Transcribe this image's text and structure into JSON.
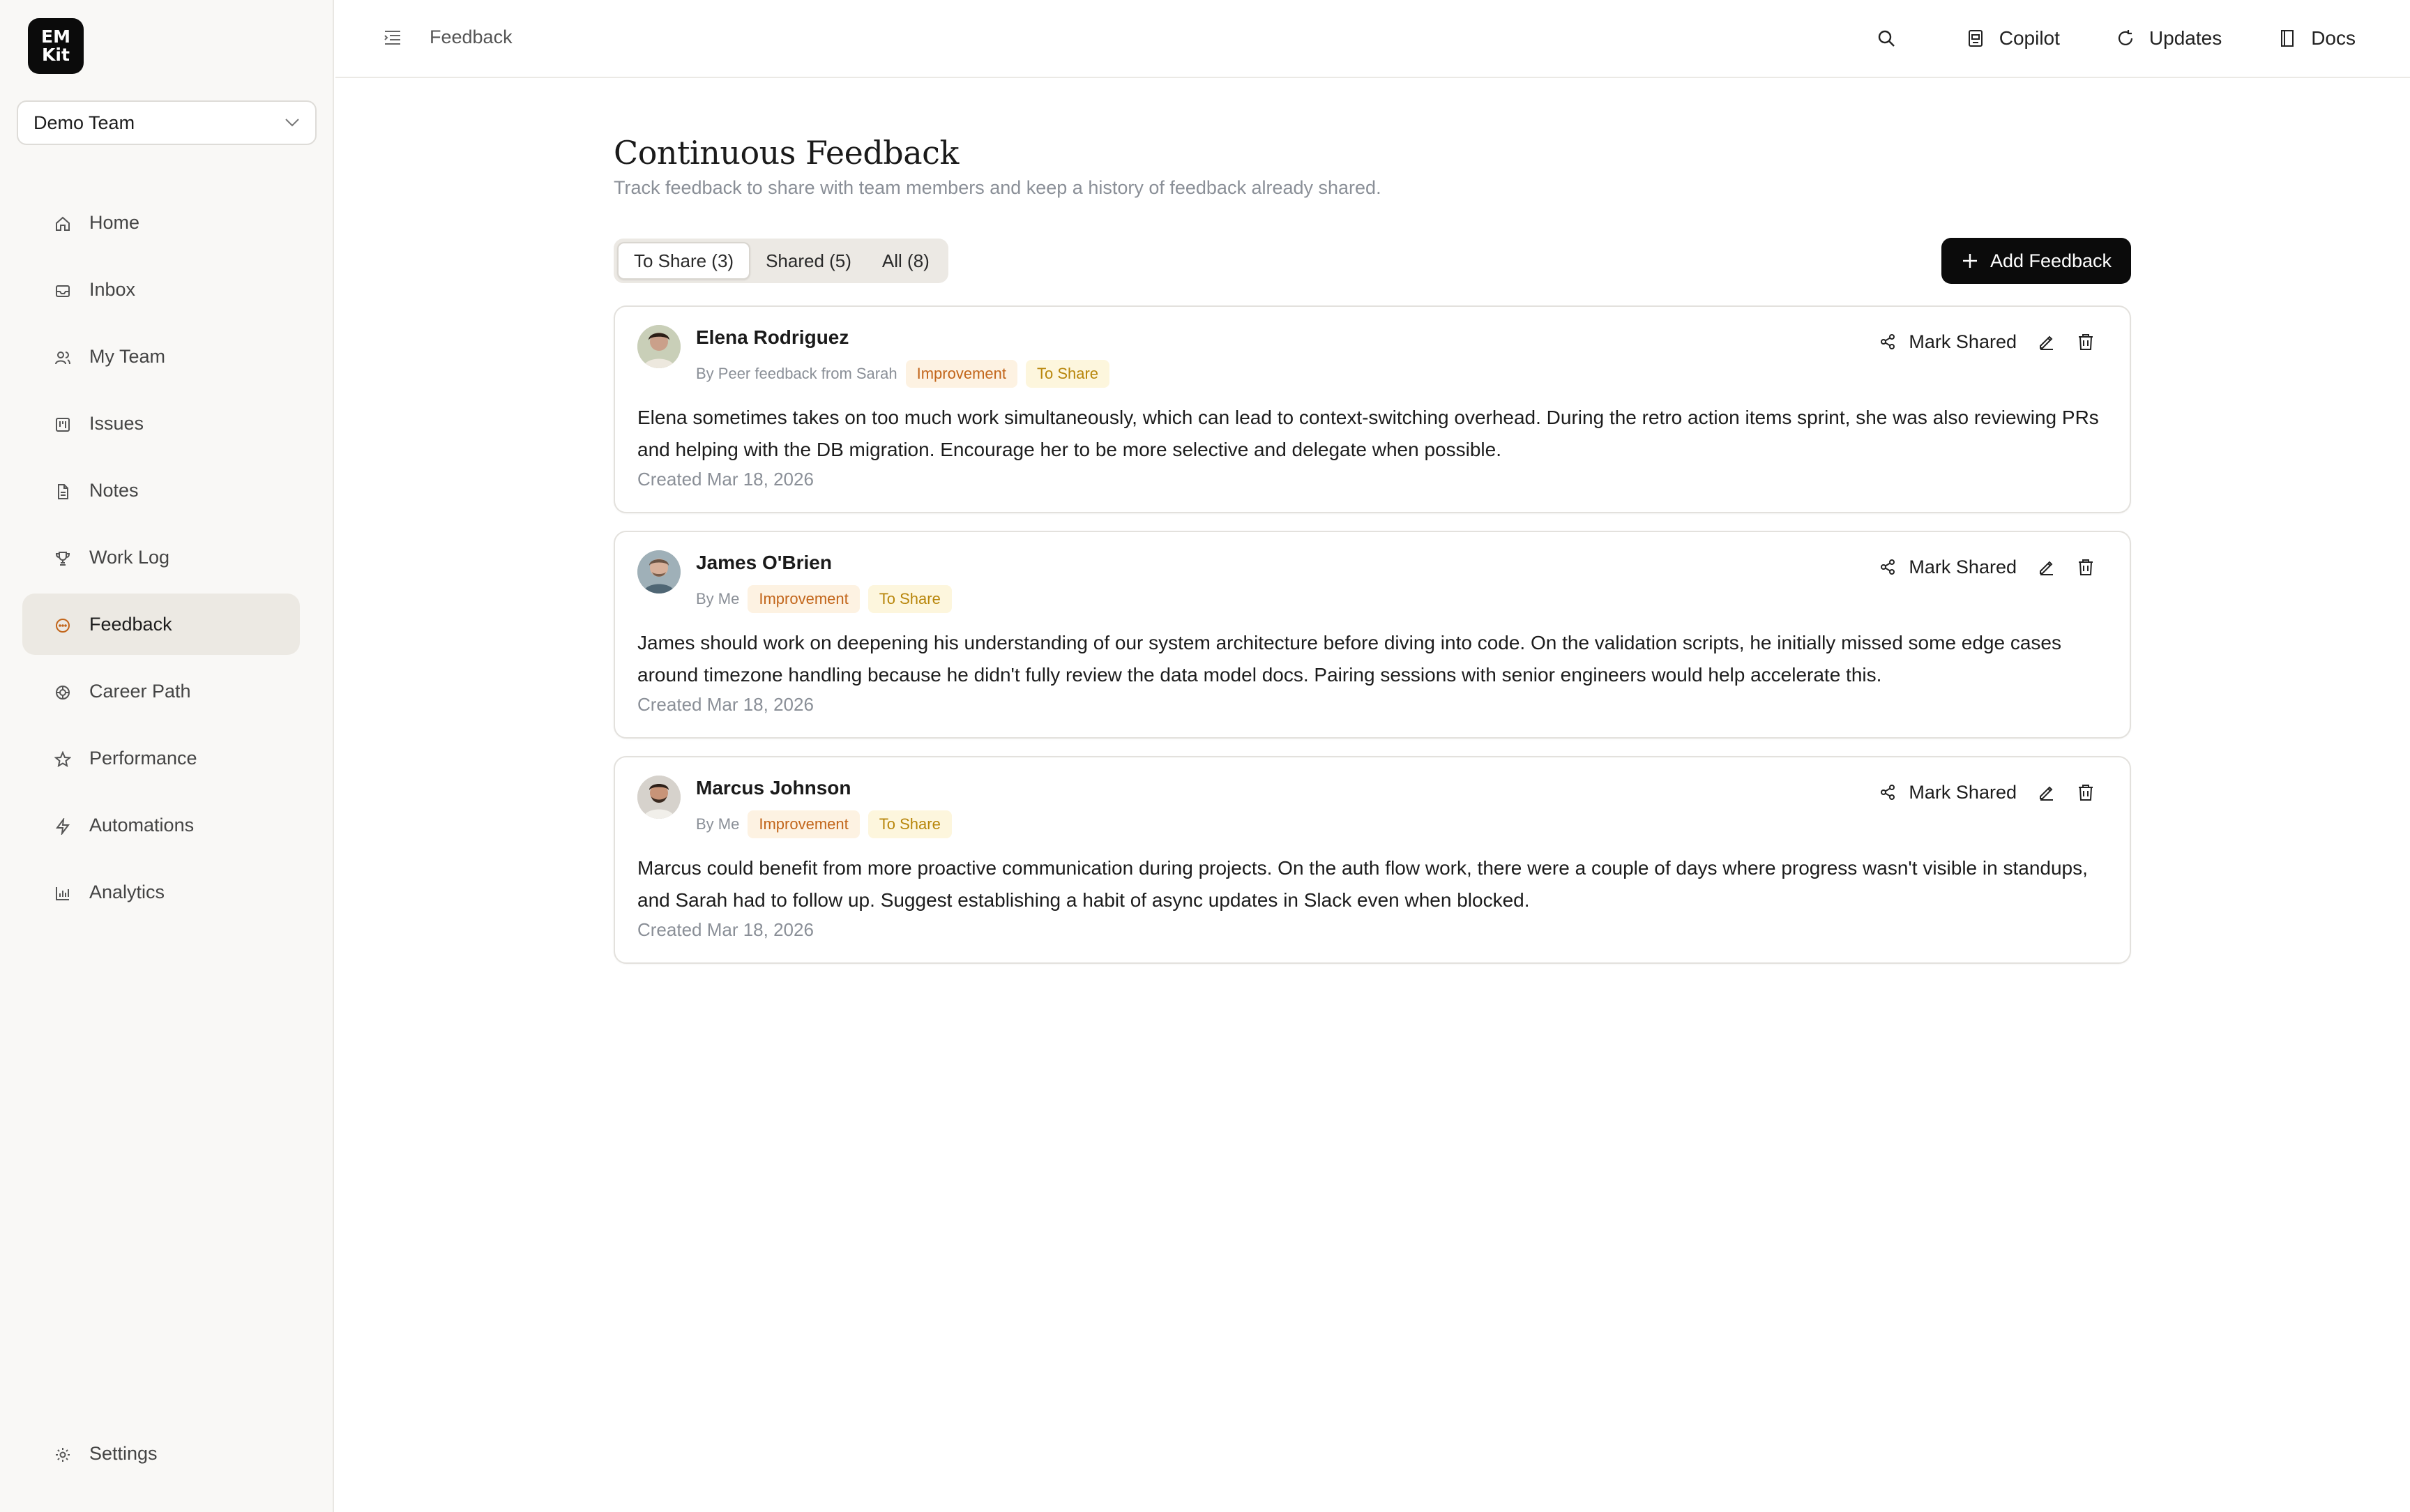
{
  "sidebar": {
    "logo": {
      "line1": "EM",
      "line2": "Kit"
    },
    "team": "Demo Team",
    "items": [
      {
        "label": "Home",
        "icon": "home-icon",
        "active": false
      },
      {
        "label": "Inbox",
        "icon": "inbox-icon",
        "active": false
      },
      {
        "label": "My Team",
        "icon": "users-icon",
        "active": false
      },
      {
        "label": "Issues",
        "icon": "kanban-icon",
        "active": false
      },
      {
        "label": "Notes",
        "icon": "document-icon",
        "active": false
      },
      {
        "label": "Work Log",
        "icon": "trophy-icon",
        "active": false
      },
      {
        "label": "Feedback",
        "icon": "message-icon",
        "active": true
      },
      {
        "label": "Career Path",
        "icon": "career-icon",
        "active": false
      },
      {
        "label": "Performance",
        "icon": "star-icon",
        "active": false
      },
      {
        "label": "Automations",
        "icon": "bolt-icon",
        "active": false
      },
      {
        "label": "Analytics",
        "icon": "bar-chart-icon",
        "active": false
      }
    ],
    "settings": "Settings"
  },
  "topbar": {
    "breadcrumb": "Feedback",
    "copilot": "Copilot",
    "updates": "Updates",
    "docs": "Docs"
  },
  "main": {
    "title": "Continuous Feedback",
    "subtitle": "Track feedback to share with team members and keep a history of feedback already shared.",
    "tabs": [
      {
        "label": "To Share (3)",
        "active": true
      },
      {
        "label": "Shared (5)",
        "active": false
      },
      {
        "label": "All (8)",
        "active": false
      }
    ],
    "add_label": "Add Feedback",
    "mark_label": "Mark Shared",
    "cards": [
      {
        "name": "Elena Rodriguez",
        "by": "By Peer feedback from Sarah",
        "type": "Improvement",
        "status": "To Share",
        "text": "Elena sometimes takes on too much work simultaneously, which can lead to context-switching overhead. During the retro action items sprint, she was also reviewing PRs and helping with the DB migration. Encourage her to be more selective and delegate when possible.",
        "created": "Created Mar 18, 2026"
      },
      {
        "name": "James O'Brien",
        "by": "By Me",
        "type": "Improvement",
        "status": "To Share",
        "text": "James should work on deepening his understanding of our system architecture before diving into code. On the validation scripts, he initially missed some edge cases around timezone handling because he didn't fully review the data model docs. Pairing sessions with senior engineers would help accelerate this.",
        "created": "Created Mar 18, 2026"
      },
      {
        "name": "Marcus Johnson",
        "by": "By Me",
        "type": "Improvement",
        "status": "To Share",
        "text": "Marcus could benefit from more proactive communication during projects. On the auth flow work, there were a couple of days where progress wasn't visible in standups, and Sarah had to follow up. Suggest establishing a habit of async updates in Slack even when blocked.",
        "created": "Created Mar 18, 2026"
      }
    ]
  },
  "colors": {
    "accent": "#0b0b0b",
    "improvement_text": "#c2651a",
    "improvement_bg": "#fdf2e2",
    "to_share_text": "#b8860b",
    "to_share_bg": "#fdf6dd",
    "sidebar_bg": "#f9f8f6",
    "active_nav_bg": "#ece9e3"
  }
}
